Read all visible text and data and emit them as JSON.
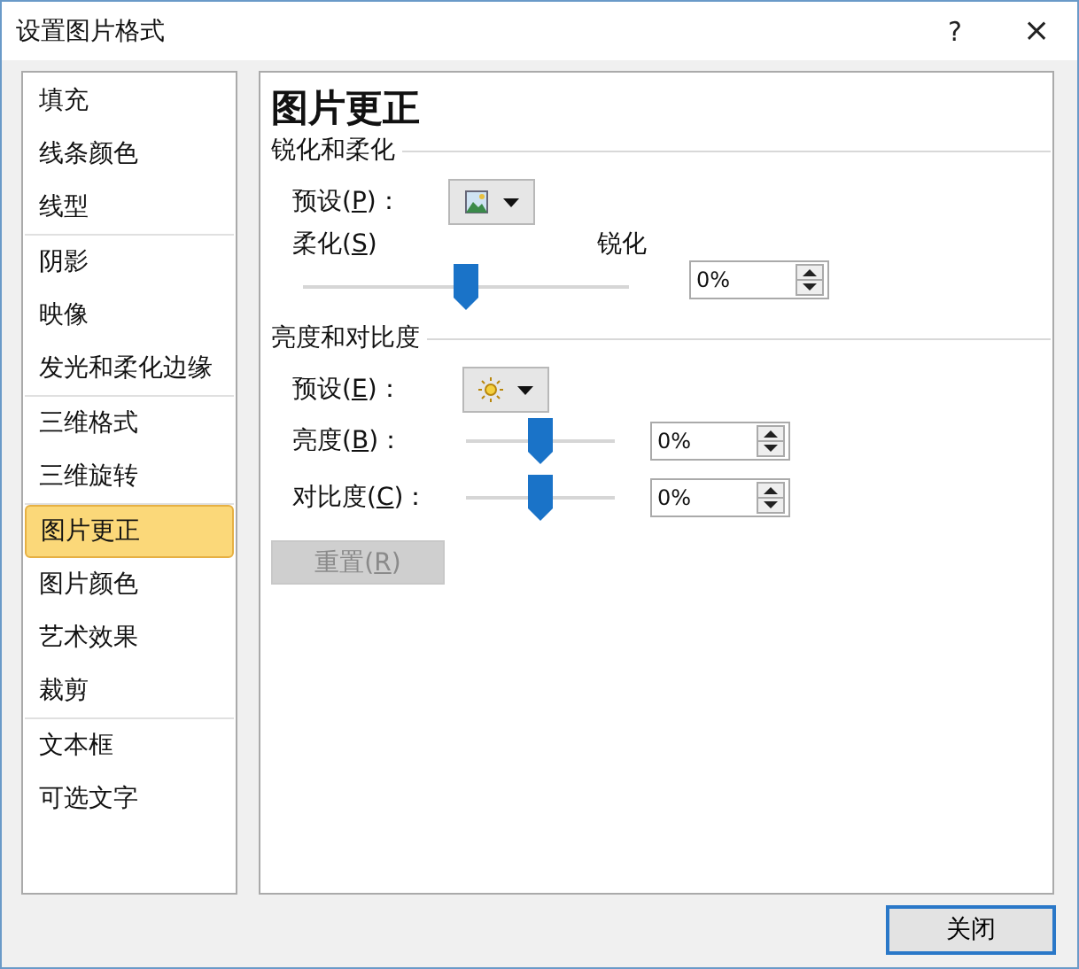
{
  "window": {
    "title": "设置图片格式",
    "help": "?",
    "close": "×"
  },
  "sidebar": {
    "groups": [
      {
        "items": [
          {
            "label": "填充",
            "selected": false
          },
          {
            "label": "线条颜色",
            "selected": false
          },
          {
            "label": "线型",
            "selected": false
          }
        ]
      },
      {
        "items": [
          {
            "label": "阴影",
            "selected": false
          },
          {
            "label": "映像",
            "selected": false
          },
          {
            "label": "发光和柔化边缘",
            "selected": false
          }
        ]
      },
      {
        "items": [
          {
            "label": "三维格式",
            "selected": false
          },
          {
            "label": "三维旋转",
            "selected": false
          }
        ]
      },
      {
        "items": [
          {
            "label": "图片更正",
            "selected": true
          },
          {
            "label": "图片颜色",
            "selected": false
          },
          {
            "label": "艺术效果",
            "selected": false
          },
          {
            "label": "裁剪",
            "selected": false
          }
        ]
      },
      {
        "items": [
          {
            "label": "文本框",
            "selected": false
          },
          {
            "label": "可选文字",
            "selected": false
          }
        ]
      }
    ]
  },
  "panel": {
    "title": "图片更正",
    "sections": [
      {
        "title": "锐化和柔化",
        "preset": {
          "label": "预设(",
          "key": "P",
          "after": ")："
        },
        "rows": [
          {
            "kind": "range",
            "left": "柔化(",
            "key": "S",
            "after": ")",
            "right": "锐化",
            "level": 0.5,
            "value": "0%"
          }
        ]
      },
      {
        "title": "亮度和对比度",
        "preset": {
          "label": "预设(",
          "key": "E",
          "after": ")："
        },
        "rows": [
          {
            "kind": "inline",
            "left": "亮度(",
            "key": "B",
            "after": ")：",
            "level": 0.5,
            "value": "0%"
          },
          {
            "kind": "inline",
            "left": "对比度(",
            "key": "C",
            "after": ")：",
            "level": 0.5,
            "value": "0%"
          }
        ]
      }
    ],
    "reset": {
      "label": "重置(",
      "key": "R",
      "after": ")",
      "disabled": true
    }
  },
  "footer": {
    "close_label": "关闭"
  }
}
